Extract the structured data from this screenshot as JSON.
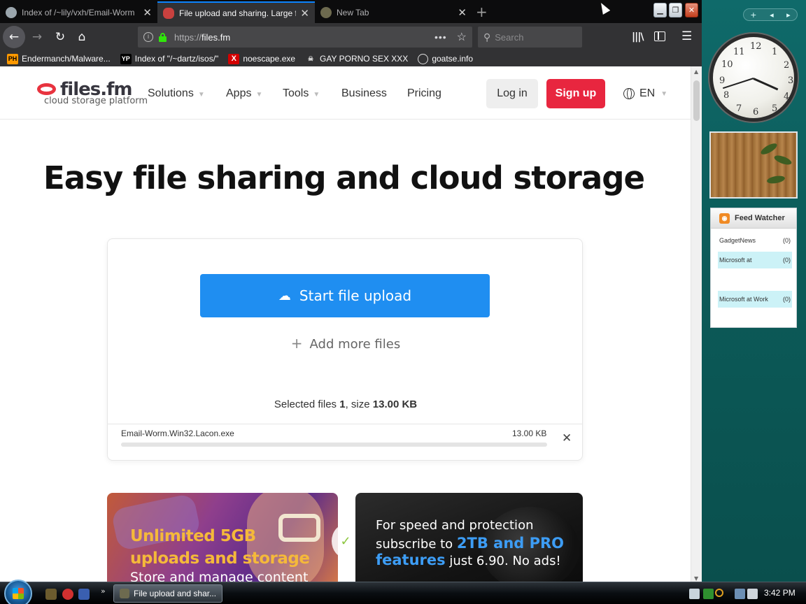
{
  "browser": {
    "tabs": [
      {
        "title": "Index of /~lily/vxh/Email-Worm",
        "active": false
      },
      {
        "title": "File upload and sharing. Large f",
        "active": true
      },
      {
        "title": "New Tab",
        "active": false
      }
    ],
    "new_tab_symbol": "+",
    "url": {
      "scheme": "https://",
      "host": "files.fm"
    },
    "search_placeholder": "Search",
    "bookmarks": [
      {
        "icon_text": "PH",
        "label": "Endermanch/Malware..."
      },
      {
        "icon_text": "YP",
        "label": "Index of \"/~dartz/isos/\""
      },
      {
        "icon_text": "X",
        "label": "noescape.exe"
      },
      {
        "icon_text": "☠",
        "label": "GAY PORNO SEX XXX"
      },
      {
        "icon_text": "",
        "label": "goatse.info"
      }
    ]
  },
  "site": {
    "logo": {
      "name": "files.fm",
      "tagline": "cloud storage platform"
    },
    "nav": {
      "solutions": "Solutions",
      "apps": "Apps",
      "tools": "Tools",
      "business": "Business",
      "pricing": "Pricing"
    },
    "login": "Log in",
    "signup": "Sign up",
    "language": "EN",
    "hero_title": "Easy file sharing and cloud storage",
    "upload": {
      "start_button": "Start file upload",
      "add_more": "Add more files",
      "selected_prefix": "Selected files ",
      "selected_count": "1",
      "size_prefix": ", size ",
      "selected_size": "13.00 KB",
      "files": [
        {
          "name": "Email-Worm.Win32.Lacon.exe",
          "size": "13.00 KB",
          "progress": 0
        }
      ]
    },
    "promos": {
      "left_title": "Unlimited 5GB uploads and storage",
      "left_sub": "Store and manage content",
      "right_line1": "For speed and protection",
      "right_line2_prefix": "subscribe to ",
      "right_line2_highlight": "2TB and PRO",
      "right_line3_highlight": "features",
      "right_line3_suffix": " just 6.90. No ads!"
    }
  },
  "desktop": {
    "clock_numbers": [
      "12",
      "1",
      "2",
      "3",
      "4",
      "5",
      "6",
      "7",
      "8",
      "9",
      "10",
      "11"
    ],
    "feed_gadget": {
      "title": "Feed Watcher",
      "items": [
        {
          "name": "GadgetNews",
          "count": "(0)"
        },
        {
          "name": "Microsoft at",
          "count": "(0)"
        },
        {
          "name": "Microsoft at Work",
          "count": "(0)"
        }
      ]
    },
    "taskbar": {
      "task_label": "File upload and shar...",
      "time": "3:42 PM"
    }
  },
  "colors": {
    "accent_blue": "#1f8ef1",
    "signup_red": "#e8263f",
    "promo_yellow": "#f5b93a",
    "promo_blue": "#3d9df5"
  }
}
